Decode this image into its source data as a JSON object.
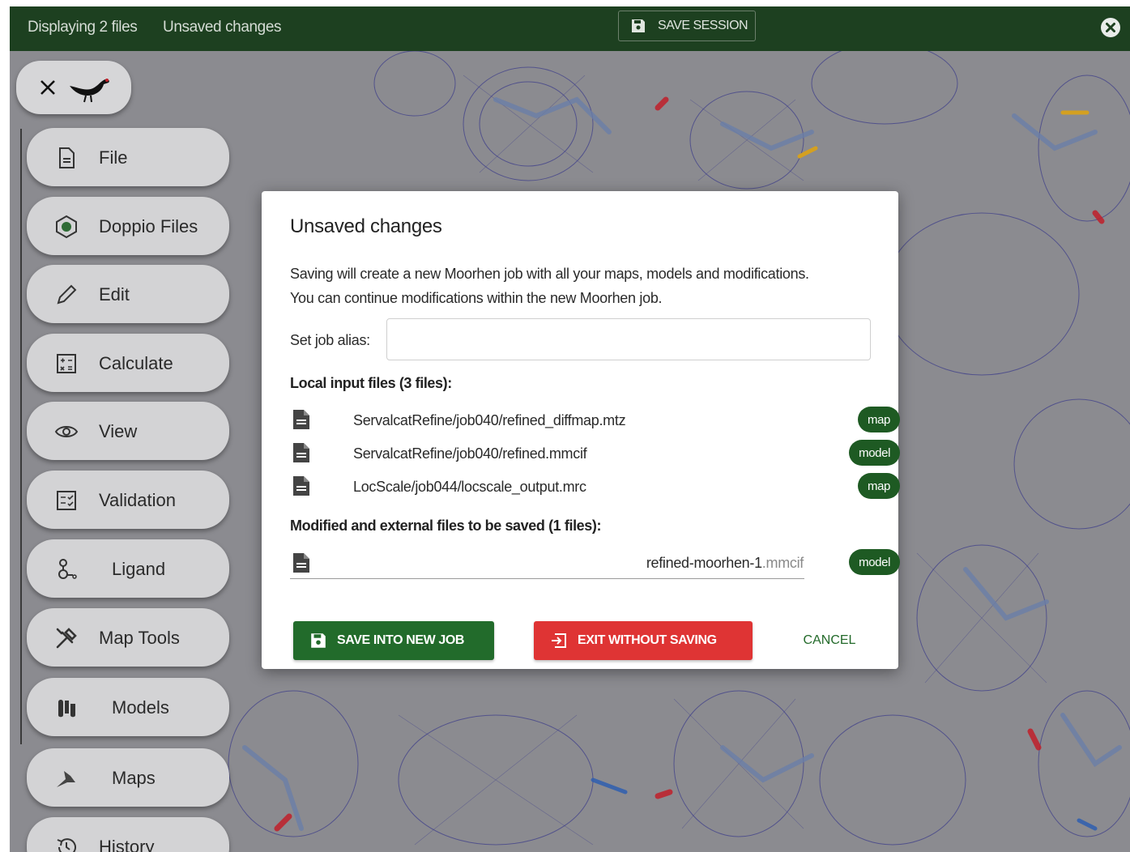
{
  "topbar": {
    "files_text": "Displaying 2 files",
    "unsaved_text": "Unsaved changes",
    "save_session_label": "SAVE SESSION"
  },
  "sidebar": {
    "items": [
      {
        "label": "File",
        "icon": "file-icon"
      },
      {
        "label": "Doppio Files",
        "icon": "doppio-icon"
      },
      {
        "label": "Edit",
        "icon": "pencil-icon"
      },
      {
        "label": "Calculate",
        "icon": "calculator-icon"
      },
      {
        "label": "View",
        "icon": "eye-icon"
      },
      {
        "label": "Validation",
        "icon": "checklist-icon"
      },
      {
        "label": "Ligand",
        "icon": "ligand-icon"
      },
      {
        "label": "Map Tools",
        "icon": "tools-icon"
      },
      {
        "label": "Models",
        "icon": "models-icon"
      },
      {
        "label": "Maps",
        "icon": "maps-icon"
      },
      {
        "label": "History",
        "icon": "history-icon"
      }
    ]
  },
  "modal": {
    "title": "Unsaved changes",
    "description_line1": "Saving will create a new Moorhen job with all your maps, models and modifications.",
    "description_line2": "You can continue modifications within the new Moorhen job.",
    "alias_label": "Set job alias:",
    "alias_value": "",
    "local_files_heading": "Local input files (3 files):",
    "local_files": [
      {
        "name": "ServalcatRefine/job040/refined_diffmap.mtz",
        "badge": "map"
      },
      {
        "name": "ServalcatRefine/job040/refined.mmcif",
        "badge": "model"
      },
      {
        "name": "LocScale/job044/locscale_output.mrc",
        "badge": "map"
      }
    ],
    "modified_heading": "Modified and external files to be saved (1 files):",
    "modified_file": {
      "name": "refined-moorhen-1",
      "ext": ".mmcif",
      "badge": "model"
    },
    "save_button": "SAVE INTO NEW JOB",
    "exit_button": "EXIT WITHOUT SAVING",
    "cancel_button": "CANCEL"
  },
  "colors": {
    "topbar": "#1d4020",
    "badge": "#1e5a23",
    "save_button": "#226b2b",
    "exit_button": "#df3434"
  }
}
